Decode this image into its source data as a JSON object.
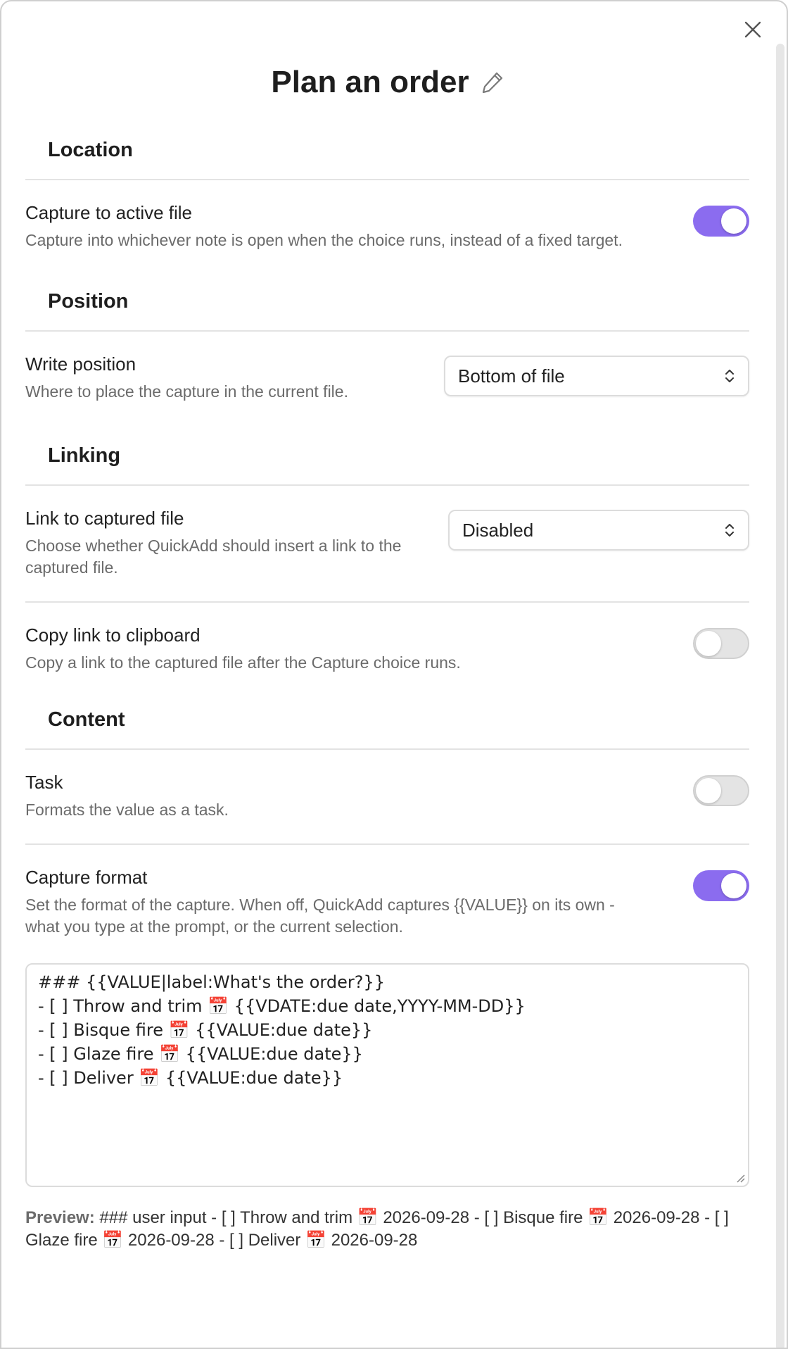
{
  "modal": {
    "title": "Plan an order",
    "close_icon": "close-icon",
    "edit_icon": "pencil-icon"
  },
  "colors": {
    "accent": "#8b6cef",
    "toggle_off": "#e4e4e4",
    "text_primary": "#222222",
    "text_muted": "#6b6b6b",
    "divider": "#e3e3e3"
  },
  "sections": {
    "location": {
      "heading": "Location",
      "capture_active": {
        "name": "Capture to active file",
        "desc": "Capture into whichever note is open when the choice runs, instead of a fixed target.",
        "enabled": true
      }
    },
    "position": {
      "heading": "Position",
      "write_position": {
        "name": "Write position",
        "desc": "Where to place the capture in the current file.",
        "value": "Bottom of file"
      }
    },
    "linking": {
      "heading": "Linking",
      "link_captured": {
        "name": "Link to captured file",
        "desc": "Choose whether QuickAdd should insert a link to the captured file.",
        "value": "Disabled"
      },
      "copy_link": {
        "name": "Copy link to clipboard",
        "desc": "Copy a link to the captured file after the Capture choice runs.",
        "enabled": false
      }
    },
    "content": {
      "heading": "Content",
      "task": {
        "name": "Task",
        "desc": "Formats the value as a task.",
        "enabled": false
      },
      "capture_format": {
        "name": "Capture format",
        "desc": "Set the format of the capture. When off, QuickAdd captures {{VALUE}} on its own - what you type at the prompt, or the current selection.",
        "enabled": true
      }
    }
  },
  "format_editor": {
    "lines": [
      "### {{VALUE|label:What's the order?}}",
      "- [ ] Throw and trim 📅 {{VDATE:due date,YYYY-MM-DD}}",
      "- [ ] Bisque fire 📅 {{VALUE:due date}}",
      "- [ ] Glaze fire 📅 {{VALUE:due date}}",
      "- [ ] Deliver 📅 {{VALUE:due date}}"
    ]
  },
  "preview": {
    "label": "Preview:",
    "text": " ### user input - [ ] Throw and trim 📅 2026-09-28 - [ ] Bisque fire 📅 2026-09-28 - [ ] Glaze fire 📅 2026-09-28 - [ ] Deliver 📅 2026-09-28"
  }
}
